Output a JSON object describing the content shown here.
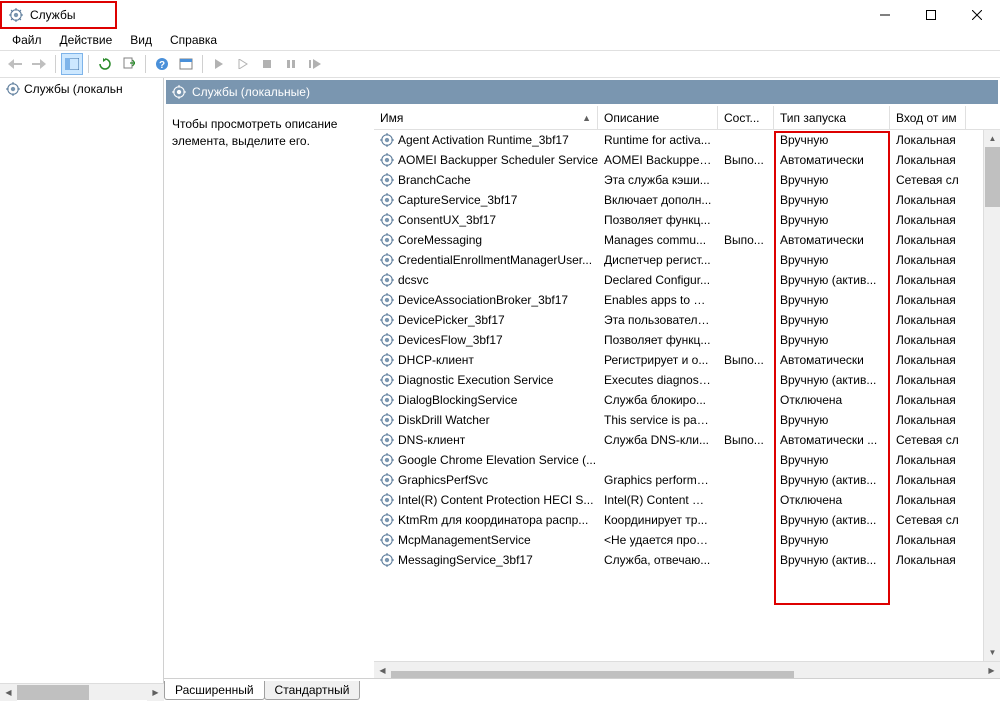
{
  "window": {
    "title": "Службы"
  },
  "menu": {
    "file": "Файл",
    "action": "Действие",
    "view": "Вид",
    "help": "Справка"
  },
  "sidebar": {
    "root": "Службы (локальн"
  },
  "tab_header": "Службы (локальные)",
  "description_hint": "Чтобы просмотреть описание элемента, выделите его.",
  "columns": {
    "name": "Имя",
    "description": "Описание",
    "status": "Сост...",
    "startup": "Тип запуска",
    "logon": "Вход от им"
  },
  "bottom_tabs": {
    "extended": "Расширенный",
    "standard": "Стандартный"
  },
  "services": [
    {
      "name": "Agent Activation Runtime_3bf17",
      "description": "Runtime for activa...",
      "status": "",
      "startup": "Вручную",
      "logon": "Локальная"
    },
    {
      "name": "AOMEI Backupper Scheduler Service",
      "description": "AOMEI Backupper...",
      "status": "Выпо...",
      "startup": "Автоматически",
      "logon": "Локальная"
    },
    {
      "name": "BranchCache",
      "description": "Эта служба кэши...",
      "status": "",
      "startup": "Вручную",
      "logon": "Сетевая сл"
    },
    {
      "name": "CaptureService_3bf17",
      "description": "Включает дополн...",
      "status": "",
      "startup": "Вручную",
      "logon": "Локальная"
    },
    {
      "name": "ConsentUX_3bf17",
      "description": "Позволяет функц...",
      "status": "",
      "startup": "Вручную",
      "logon": "Локальная"
    },
    {
      "name": "CoreMessaging",
      "description": "Manages commu...",
      "status": "Выпо...",
      "startup": "Автоматически",
      "logon": "Локальная"
    },
    {
      "name": "CredentialEnrollmentManagerUser...",
      "description": "Диспетчер регист...",
      "status": "",
      "startup": "Вручную",
      "logon": "Локальная"
    },
    {
      "name": "dcsvc",
      "description": "Declared Configur...",
      "status": "",
      "startup": "Вручную (актив...",
      "logon": "Локальная"
    },
    {
      "name": "DeviceAssociationBroker_3bf17",
      "description": "Enables apps to pa...",
      "status": "",
      "startup": "Вручную",
      "logon": "Локальная"
    },
    {
      "name": "DevicePicker_3bf17",
      "description": "Эта пользователь...",
      "status": "",
      "startup": "Вручную",
      "logon": "Локальная"
    },
    {
      "name": "DevicesFlow_3bf17",
      "description": "Позволяет функц...",
      "status": "",
      "startup": "Вручную",
      "logon": "Локальная"
    },
    {
      "name": "DHCP-клиент",
      "description": "Регистрирует и о...",
      "status": "Выпо...",
      "startup": "Автоматически",
      "logon": "Локальная"
    },
    {
      "name": "Diagnostic Execution Service",
      "description": "Executes diagnosti...",
      "status": "",
      "startup": "Вручную (актив...",
      "logon": "Локальная"
    },
    {
      "name": "DialogBlockingService",
      "description": "Служба блокиро...",
      "status": "",
      "startup": "Отключена",
      "logon": "Локальная"
    },
    {
      "name": "DiskDrill Watcher",
      "description": "This service is part ...",
      "status": "",
      "startup": "Вручную",
      "logon": "Локальная"
    },
    {
      "name": "DNS-клиент",
      "description": "Служба DNS-кли...",
      "status": "Выпо...",
      "startup": "Автоматически ...",
      "logon": "Сетевая сл"
    },
    {
      "name": "Google Chrome Elevation Service (...",
      "description": "",
      "status": "",
      "startup": "Вручную",
      "logon": "Локальная"
    },
    {
      "name": "GraphicsPerfSvc",
      "description": "Graphics performa...",
      "status": "",
      "startup": "Вручную (актив...",
      "logon": "Локальная"
    },
    {
      "name": "Intel(R) Content Protection HECI S...",
      "description": "Intel(R) Content Pr...",
      "status": "",
      "startup": "Отключена",
      "logon": "Локальная"
    },
    {
      "name": "KtmRm для координатора распр...",
      "description": "Координирует тр...",
      "status": "",
      "startup": "Вручную (актив...",
      "logon": "Сетевая сл"
    },
    {
      "name": "McpManagementService",
      "description": "<Не удается проч...",
      "status": "",
      "startup": "Вручную",
      "logon": "Локальная"
    },
    {
      "name": "MessagingService_3bf17",
      "description": "Служба, отвечаю...",
      "status": "",
      "startup": "Вручную (актив...",
      "logon": "Локальная"
    }
  ]
}
